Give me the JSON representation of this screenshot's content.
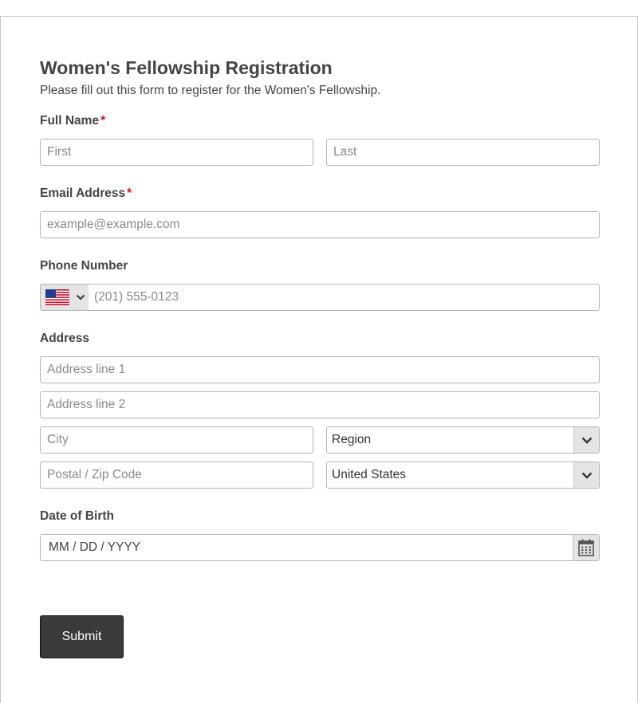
{
  "form": {
    "title": "Women's Fellowship Registration",
    "description": "Please fill out this form to register for the Women's Fellowship.",
    "required_mark": "*",
    "full_name": {
      "label": "Full Name",
      "first_placeholder": "First",
      "last_placeholder": "Last"
    },
    "email": {
      "label": "Email Address",
      "placeholder": "example@example.com"
    },
    "phone": {
      "label": "Phone Number",
      "placeholder": "(201) 555-0123",
      "country_flag_icon": "us-flag-icon"
    },
    "address": {
      "label": "Address",
      "line1_placeholder": "Address line 1",
      "line2_placeholder": "Address line 2",
      "city_placeholder": "City",
      "region_value": "Region",
      "postal_placeholder": "Postal / Zip Code",
      "country_value": "United States"
    },
    "dob": {
      "label": "Date of Birth",
      "placeholder": "MM / DD / YYYY"
    },
    "submit_label": "Submit"
  },
  "colors": {
    "required": "#c8191f",
    "submit_bg": "#3a3a3a",
    "border": "#b4b4b4"
  }
}
